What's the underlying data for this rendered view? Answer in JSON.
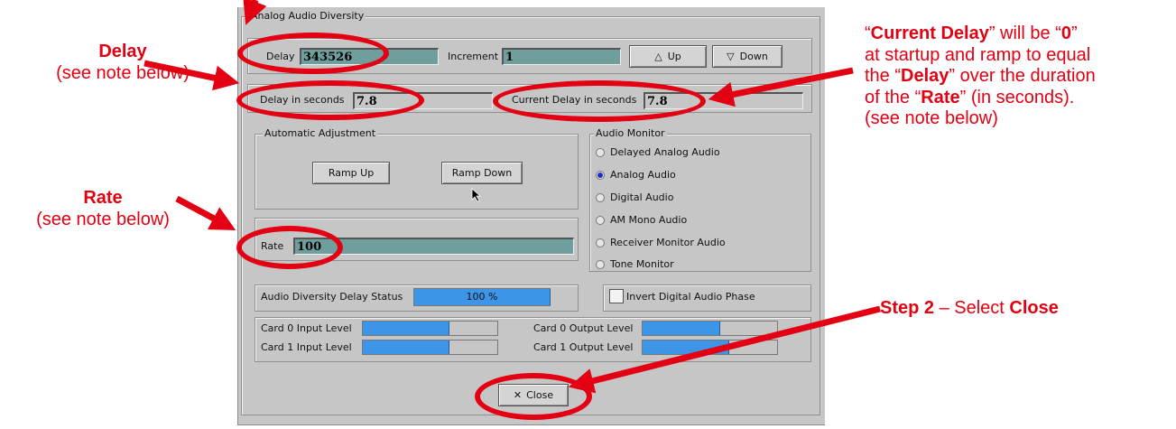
{
  "window": {
    "group_title": "Analog Audio Diversity"
  },
  "delay_row": {
    "delay_label": "Delay",
    "delay_value": "343526",
    "increment_label": "Increment",
    "increment_value": "1",
    "up_label": "Up",
    "down_label": "Down"
  },
  "seconds_row": {
    "delay_seconds_label": "Delay in seconds",
    "delay_seconds_value": "7.8",
    "current_delay_label": "Current Delay in seconds",
    "current_delay_value": "7.8"
  },
  "automatic": {
    "title": "Automatic Adjustment",
    "ramp_up": "Ramp Up",
    "ramp_down": "Ramp Down"
  },
  "rate": {
    "label": "Rate",
    "value": "100"
  },
  "audio_monitor": {
    "title": "Audio Monitor",
    "options": [
      {
        "label": "Delayed Analog  Audio",
        "selected": false
      },
      {
        "label": "Analog Audio",
        "selected": true
      },
      {
        "label": "Digital Audio",
        "selected": false
      },
      {
        "label": "AM Mono Audio",
        "selected": false
      },
      {
        "label": "Receiver Monitor Audio",
        "selected": false
      },
      {
        "label": "Tone Monitor",
        "selected": false
      }
    ]
  },
  "status": {
    "label": "Audio Diversity Delay Status",
    "value_text": "100 %",
    "progress": 1.0
  },
  "invert": {
    "label": "Invert Digital Audio Phase",
    "checked": false
  },
  "levels": {
    "card0_input_label": "Card 0 Input Level",
    "card0_input_level": 0.64,
    "card1_input_label": "Card 1 Input Level",
    "card1_input_level": 0.64,
    "card0_output_label": "Card 0 Output Level",
    "card0_output_level": 0.57,
    "card1_output_label": "Card 1 Output Level",
    "card1_output_level": 0.64
  },
  "close_button": {
    "label": "Close",
    "icon": "x-icon"
  },
  "annotations": {
    "delay_title": "Delay",
    "delay_note": "(see note below)",
    "rate_title": "Rate",
    "rate_note": "(see note below)",
    "current_q1": "“",
    "current_b1": "Current Delay",
    "current_t1": "” will be “",
    "current_b2": "0",
    "current_t2": "”",
    "current_line2": "at startup and ramp to equal",
    "current_t3": "the “",
    "current_b3": "Delay",
    "current_t4": "” over the duration",
    "current_t5": "of the “",
    "current_b4": "Rate",
    "current_t6": "” (in seconds).",
    "current_note": "(see note below)",
    "step2_bold": "Step 2",
    "step2_text": " – Select ",
    "step2_close": "Close"
  },
  "colors": {
    "annotation": "#e30012",
    "field": "#6f9f9d",
    "meter": "#3d95e8",
    "panel": "#c6c6c6"
  }
}
